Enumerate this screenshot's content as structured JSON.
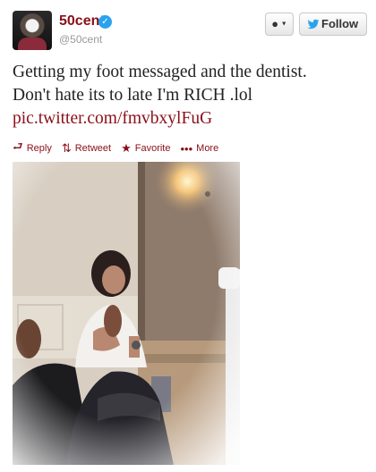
{
  "user": {
    "name": "50cent",
    "handle": "@50cent",
    "verified_mark": "✓"
  },
  "buttons": {
    "user_menu_icon": "user-dropdown-icon",
    "follow_label": "Follow"
  },
  "tweet": {
    "text_line1": "Getting my foot messaged and the dentist.",
    "text_line2": "Don't hate its to late I'm RICH .lol",
    "link": "pic.twitter.com/fmvbxylFuG"
  },
  "actions": {
    "reply": "Reply",
    "retweet": "Retweet",
    "favorite": "Favorite",
    "more": "More"
  },
  "colors": {
    "name": "#8a0f18",
    "accent": "#2aa3ef"
  }
}
